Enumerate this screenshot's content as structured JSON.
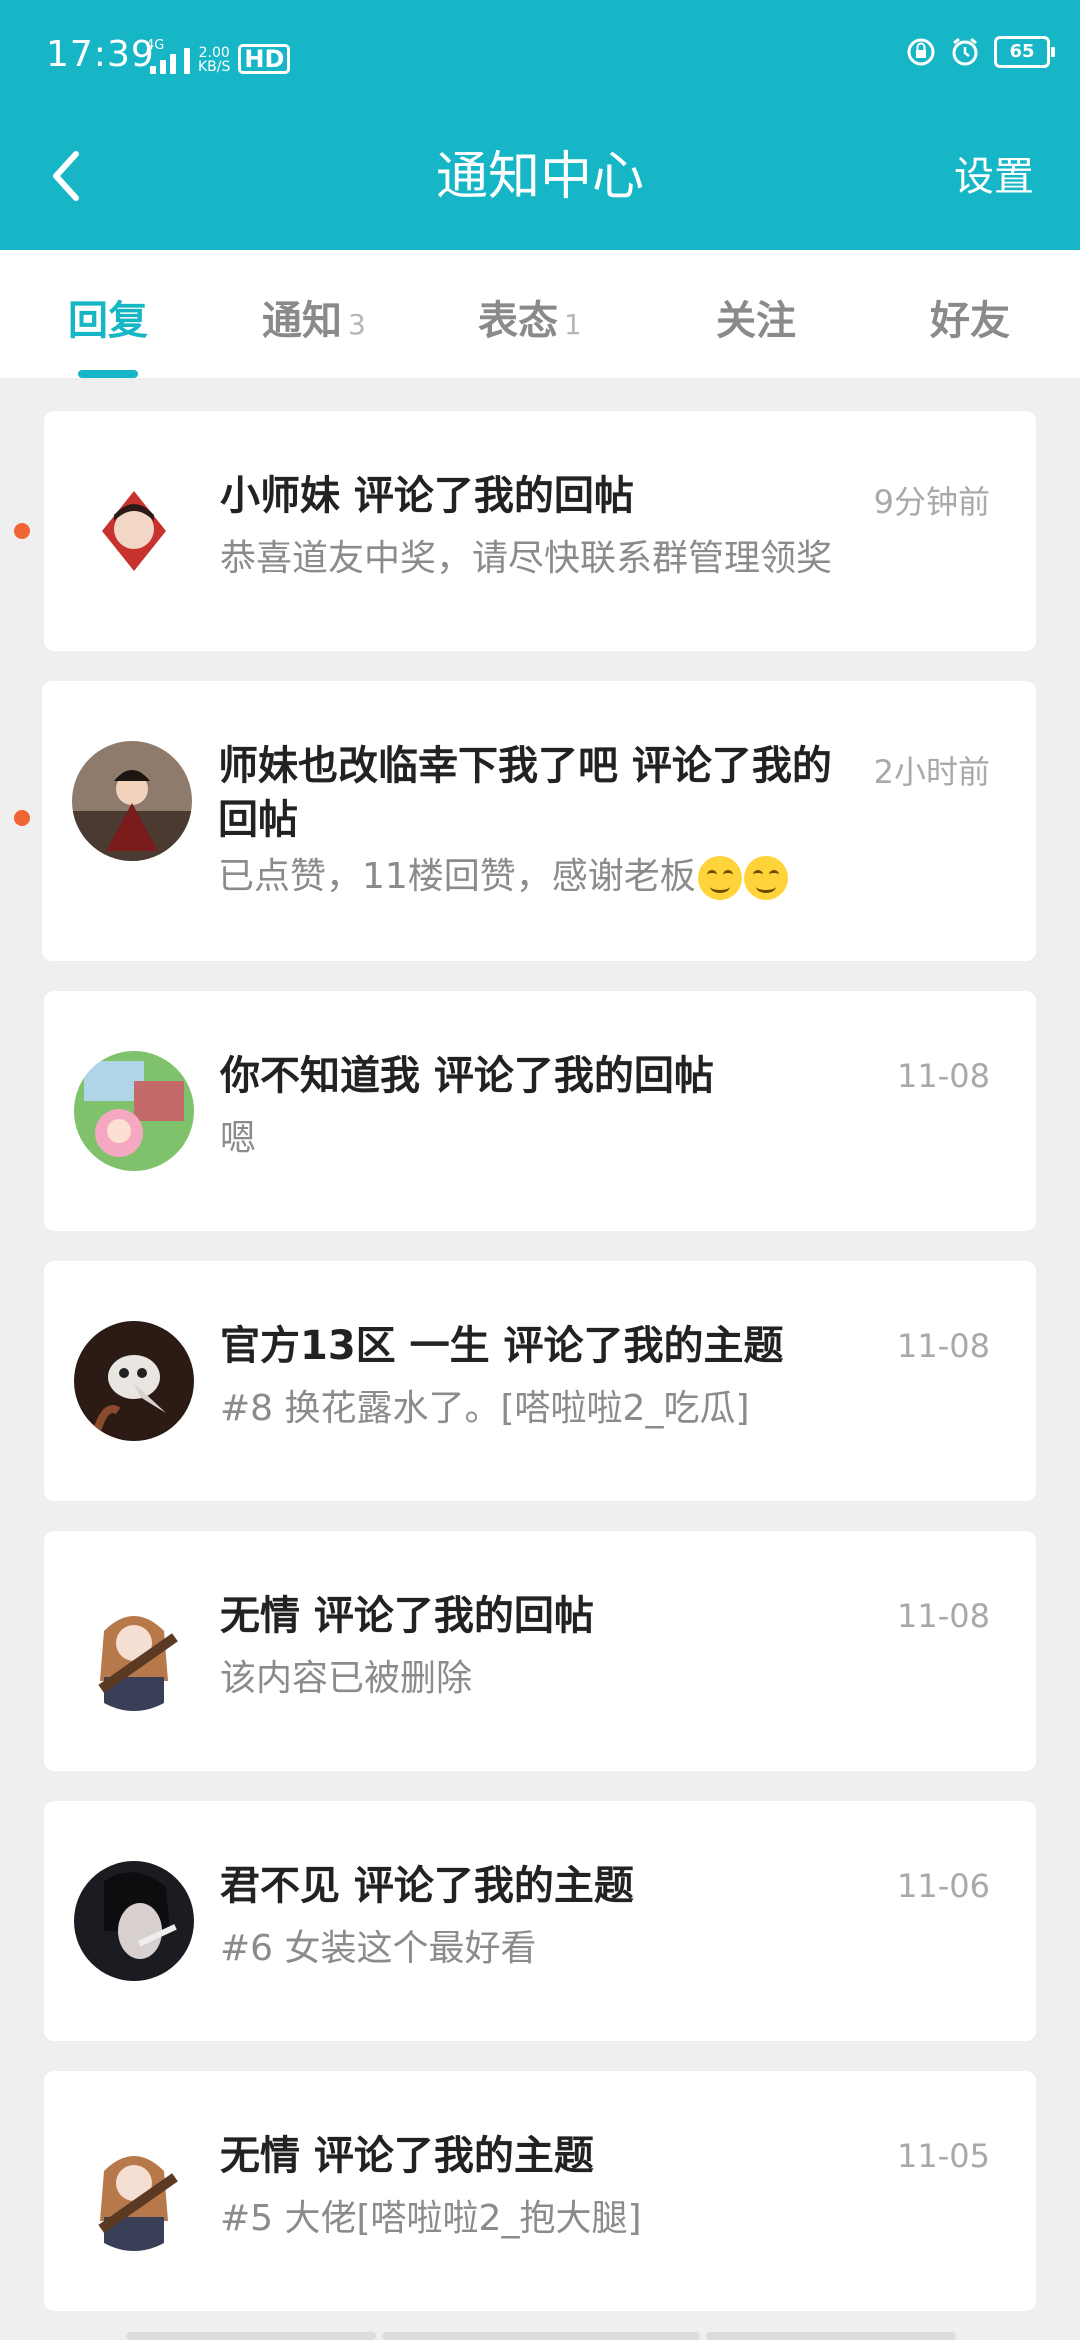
{
  "status_bar": {
    "time": "17:39",
    "network": "4G",
    "speed_top": "2.00",
    "speed_bottom": "KB/S",
    "hd": "HD",
    "battery": "65"
  },
  "header": {
    "title": "通知中心",
    "settings_label": "设置"
  },
  "tabs": [
    {
      "label": "回复",
      "count": ""
    },
    {
      "label": "通知",
      "count": "3"
    },
    {
      "label": "表态",
      "count": "1"
    },
    {
      "label": "关注",
      "count": ""
    },
    {
      "label": "好友",
      "count": ""
    }
  ],
  "colors": {
    "accent": "#16b6c6",
    "unread_dot": "#f06533",
    "background": "#efefef"
  },
  "notifications": [
    {
      "title": "小师妹 评论了我的回帖",
      "time": "9分钟前",
      "content": "恭喜道友中奖，请尽快联系群管理领奖",
      "unread": true
    },
    {
      "title": "师妹也改临幸下我了吧 评论了我的回帖",
      "time": "2小时前",
      "content": "已点赞，11楼回赞，感谢老板",
      "unread": true
    },
    {
      "title": "你不知道我 评论了我的回帖",
      "time": "11-08",
      "content": "嗯",
      "unread": false
    },
    {
      "title": "官方13区  一生 评论了我的主题",
      "time": "11-08",
      "content": "#8 换花露水了。[嗒啦啦2_吃瓜]",
      "unread": false
    },
    {
      "title": "无情 评论了我的回帖",
      "time": "11-08",
      "content": "该内容已被删除",
      "unread": false
    },
    {
      "title": "君不见 评论了我的主题",
      "time": "11-06",
      "content": "#6 女装这个最好看",
      "unread": false
    },
    {
      "title": "无情 评论了我的主题",
      "time": "11-05",
      "content": "#5 大佬[嗒啦啦2_抱大腿]",
      "unread": false
    }
  ]
}
